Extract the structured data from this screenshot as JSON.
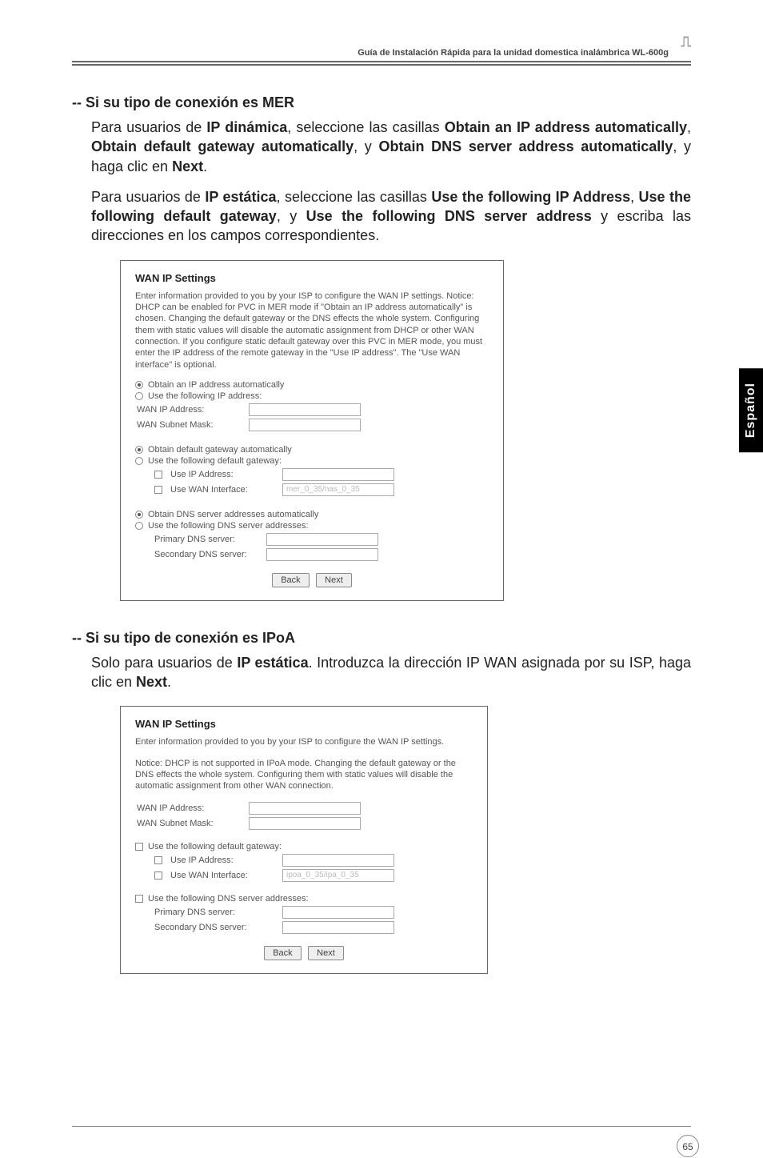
{
  "header": {
    "guide_title": "Guía de Instalación Rápida para la unidad domestica inalámbrica WL-600g"
  },
  "side_tab": "Español",
  "page_number": "65",
  "sec1": {
    "title": "-- Si su tipo de conexión es MER",
    "p1_a": "Para usuarios de ",
    "p1_b": "IP dinámica",
    "p1_c": ", seleccione las casillas ",
    "p1_d": "Obtain an IP address automatically",
    "p1_e": ", ",
    "p1_f": "Obtain default gateway automatically",
    "p1_g": ", y ",
    "p1_h": "Obtain DNS server address automatically",
    "p1_i": ", y haga clic en ",
    "p1_j": "Next",
    "p1_k": ".",
    "p2_a": "Para  usuarios de ",
    "p2_b": "IP estática",
    "p2_c": ", seleccione las casillas ",
    "p2_d": "Use the following IP Address",
    "p2_e": ", ",
    "p2_f": "Use the following default gateway",
    "p2_g": ", y ",
    "p2_h": "Use the following DNS server address",
    "p2_i": " y escriba las direcciones en los campos correspondientes."
  },
  "shot1": {
    "title": "WAN IP Settings",
    "para": "Enter information provided to you by your ISP to configure the WAN IP settings. Notice: DHCP can be enabled for PVC in MER mode if \"Obtain an IP address automatically\" is chosen. Changing the default gateway or the DNS effects the whole system. Configuring them with static values will disable the automatic assignment from DHCP or other WAN connection. If you configure static default gateway over this PVC in MER mode, you must enter the IP address of the remote gateway in the \"Use IP address\". The \"Use WAN interface\" is optional.",
    "r1a": "Obtain an IP address automatically",
    "r1b": "Use the following IP address:",
    "f_wanip": "WAN IP Address:",
    "f_mask": "WAN Subnet Mask:",
    "r2a": "Obtain default gateway automatically",
    "r2b": "Use the following default gateway:",
    "f_useip": "Use IP Address:",
    "f_usewan": "Use WAN Interface:",
    "f_usewan_val": "mer_0_35/nas_0_35",
    "r3a": "Obtain DNS server addresses automatically",
    "r3b": "Use the following DNS server addresses:",
    "f_pdns": "Primary DNS server:",
    "f_sdns": "Secondary DNS server:",
    "btn_back": "Back",
    "btn_next": "Next"
  },
  "sec2": {
    "title": "-- Si su tipo de conexión es IPoA",
    "p1_a": "Solo para usuarios de ",
    "p1_b": "IP estática",
    "p1_c": ". Introduzca la dirección IP WAN asignada por su ISP, haga clic en ",
    "p1_d": "Next",
    "p1_e": "."
  },
  "shot2": {
    "title": "WAN IP Settings",
    "para1": "Enter information provided to you by your ISP to configure the WAN IP settings.",
    "para2": "Notice: DHCP is not supported in IPoA mode. Changing the default gateway or the DNS effects the whole system. Configuring them with static values will disable the automatic assignment from other WAN connection.",
    "f_wanip": "WAN IP Address:",
    "f_mask": "WAN Subnet Mask:",
    "c1": "Use the following default gateway:",
    "f_useip": "Use IP Address:",
    "f_usewan": "Use WAN Interface:",
    "f_usewan_val": "ipoa_0_35/ipa_0_35",
    "c2": "Use the following DNS server addresses:",
    "f_pdns": "Primary DNS server:",
    "f_sdns": "Secondary DNS server:",
    "btn_back": "Back",
    "btn_next": "Next"
  }
}
